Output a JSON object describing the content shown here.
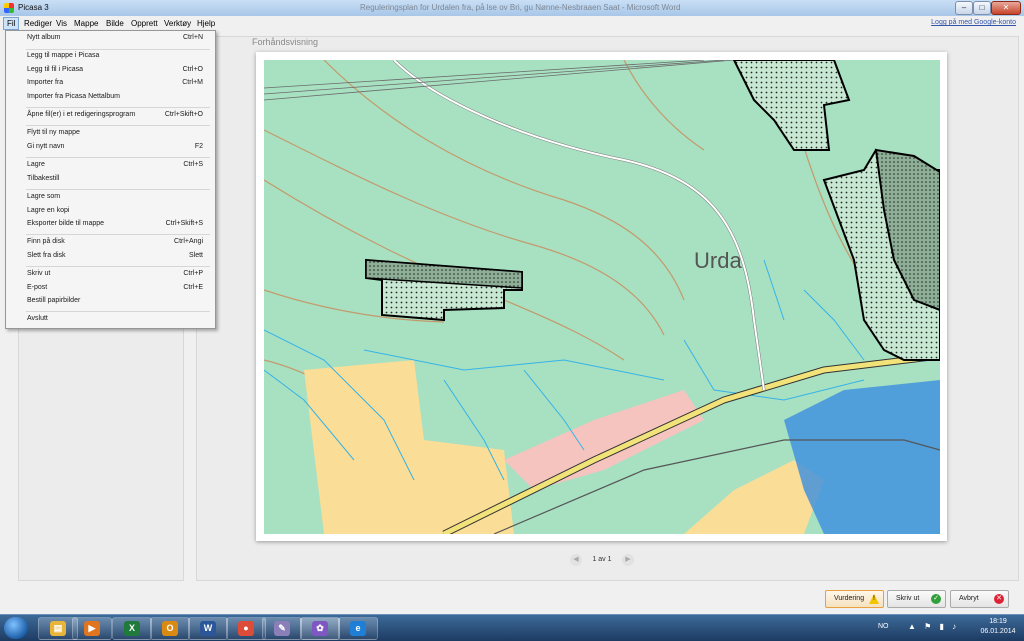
{
  "window": {
    "app_title": "Picasa 3",
    "document_title": "Reguleringsplan for Urdalen fra, på lse ov Bri, gu Nønne-Nesbraaen Saat - Microsoft Word"
  },
  "title_buttons": {
    "minimize": "–",
    "maximize": "□",
    "close": "✕"
  },
  "menubar": {
    "items": [
      "Fil",
      "Rediger",
      "Vis",
      "Mappe",
      "Bilde",
      "Opprett",
      "Verktøy",
      "Hjelp"
    ],
    "login_link": "Logg på med Google-konto"
  },
  "file_menu": {
    "items": [
      {
        "label": "Nytt album",
        "shortcut": "Ctrl+N"
      },
      {
        "label": "Legg til mappe i Picasa",
        "shortcut": ""
      },
      {
        "label": "Legg til fil i Picasa",
        "shortcut": "Ctrl+O"
      },
      {
        "label": "Importer fra",
        "shortcut": "Ctrl+M"
      },
      {
        "label": "Importer fra Picasa Nettalbum",
        "shortcut": ""
      },
      {
        "label": "Åpne fil(er) i et redigeringsprogram",
        "shortcut": "Ctrl+Skift+O"
      },
      {
        "label": "Flytt til ny mappe",
        "shortcut": ""
      },
      {
        "label": "Gi nytt navn",
        "shortcut": "F2"
      },
      {
        "label": "Lagre",
        "shortcut": "Ctrl+S"
      },
      {
        "label": "Tilbakestill",
        "shortcut": ""
      },
      {
        "label": "Lagre som",
        "shortcut": ""
      },
      {
        "label": "Lagre en kopi",
        "shortcut": ""
      },
      {
        "label": "Eksporter bilde til mappe",
        "shortcut": "Ctrl+Skift+S"
      },
      {
        "label": "Finn på disk",
        "shortcut": "Ctrl+Angi"
      },
      {
        "label": "Slett fra disk",
        "shortcut": "Slett"
      },
      {
        "label": "Skriv ut",
        "shortcut": "Ctrl+P"
      },
      {
        "label": "E-post",
        "shortcut": "Ctrl+E"
      },
      {
        "label": "Bestill papirbilder",
        "shortcut": ""
      },
      {
        "label": "Avslutt",
        "shortcut": ""
      }
    ]
  },
  "preview": {
    "label": "Forhåndsvisning",
    "map_place_name": "Urda",
    "page_indicator": "1 av 1",
    "prev_glyph": "◀",
    "next_glyph": "▶"
  },
  "actions": {
    "rating": "Vurdering",
    "print": "Skriv ut",
    "cancel": "Avbryt",
    "rating_icon_glyph": "!",
    "print_icon_glyph": "✓",
    "cancel_icon_glyph": "✕"
  },
  "taskbar": {
    "apps": [
      {
        "name": "explorer",
        "glyph": "▤",
        "color": "#e8b43a"
      },
      {
        "name": "media-player",
        "glyph": "▶",
        "color": "#e0751f"
      },
      {
        "name": "excel",
        "glyph": "X",
        "color": "#1f7a3c"
      },
      {
        "name": "outlook",
        "glyph": "O",
        "color": "#d98a12"
      },
      {
        "name": "word",
        "glyph": "W",
        "color": "#2b579a"
      },
      {
        "name": "chrome",
        "glyph": "●",
        "color": "#dd4b39"
      },
      {
        "name": "paint",
        "glyph": "✎",
        "color": "#8a7fb8"
      },
      {
        "name": "picasa",
        "glyph": "✿",
        "color": "#7e57c2"
      },
      {
        "name": "internet-explorer",
        "glyph": "e",
        "color": "#1f7fd6"
      }
    ],
    "language": "NO",
    "tray_icons": "▲ ⚑ ▮ ♪",
    "time": "18:19",
    "date": "06.01.2014"
  },
  "colors": {
    "map_forest": "#a8e0c2",
    "map_field": "#fadd96",
    "map_water": "#3a8fe0",
    "map_road": "#f1e27a",
    "map_building": "#f5c4bf"
  }
}
